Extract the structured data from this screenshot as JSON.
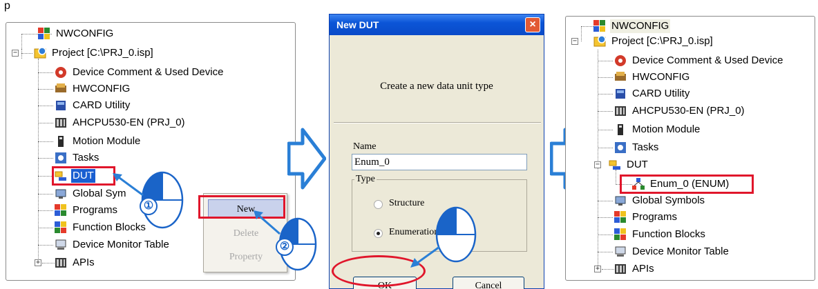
{
  "top_text": "p",
  "left_tree": {
    "items": [
      {
        "label": "NWCONFIG",
        "icon": "nwconfig-icon"
      },
      {
        "label": "Project [C:\\PRJ_0.isp]",
        "icon": "project-gear-icon"
      },
      {
        "label": "Device Comment & Used Device",
        "icon": "device-comment-icon"
      },
      {
        "label": "HWCONFIG",
        "icon": "hwconfig-icon"
      },
      {
        "label": "CARD Utility",
        "icon": "card-utility-icon"
      },
      {
        "label": "AHCPU530-EN  (PRJ_0)",
        "icon": "cpu-icon"
      },
      {
        "label": "Motion Module",
        "icon": "motion-module-icon"
      },
      {
        "label": "Tasks",
        "icon": "tasks-icon"
      },
      {
        "label": "DUT",
        "icon": "dut-folder-icon"
      },
      {
        "label": "Global Sym",
        "icon": "global-symbols-icon"
      },
      {
        "label": "Programs",
        "icon": "programs-icon"
      },
      {
        "label": "Function Blocks",
        "icon": "function-blocks-icon"
      },
      {
        "label": "Device Monitor Table",
        "icon": "device-monitor-icon"
      },
      {
        "label": "APIs",
        "icon": "apis-icon"
      }
    ]
  },
  "context_menu": {
    "items": [
      "New",
      "Delete",
      "Property"
    ]
  },
  "dialog": {
    "title": "New DUT",
    "close": "×",
    "description": "Create a new data unit type",
    "name_label": "Name",
    "name_value": "Enum_0",
    "type_label": "Type",
    "structure_label": "Structure",
    "enumeration_label": "Enumeration",
    "ok_label": "OK",
    "cancel_label": "Cancel",
    "selected_type": "Enumeration"
  },
  "right_tree": {
    "items": [
      {
        "label": "NWCONFIG",
        "icon": "nwconfig-icon"
      },
      {
        "label": "Project [C:\\PRJ_0.isp]",
        "icon": "project-gear-icon"
      },
      {
        "label": "Device Comment & Used Device",
        "icon": "device-comment-icon"
      },
      {
        "label": "HWCONFIG",
        "icon": "hwconfig-icon"
      },
      {
        "label": "CARD Utility",
        "icon": "card-utility-icon"
      },
      {
        "label": "AHCPU530-EN  (PRJ_0)",
        "icon": "cpu-icon"
      },
      {
        "label": "Motion Module",
        "icon": "motion-module-icon"
      },
      {
        "label": "Tasks",
        "icon": "tasks-icon"
      },
      {
        "label": "DUT",
        "icon": "dut-folder-icon"
      },
      {
        "label": "Enum_0 (ENUM)",
        "icon": "enum-icon"
      },
      {
        "label": "Global Symbols",
        "icon": "global-symbols-icon"
      },
      {
        "label": "Programs",
        "icon": "programs-icon"
      },
      {
        "label": "Function Blocks",
        "icon": "function-blocks-icon"
      },
      {
        "label": "Device Monitor Table",
        "icon": "device-monitor-icon"
      },
      {
        "label": "APIs",
        "icon": "apis-icon"
      }
    ]
  },
  "badges": [
    "①",
    "②"
  ],
  "colors": {
    "highlight_red": "#e0162b",
    "arrow_blue": "#2a7fd6",
    "selection_blue": "#1a5fd1",
    "titlebar_blue": "#0b55d7"
  }
}
